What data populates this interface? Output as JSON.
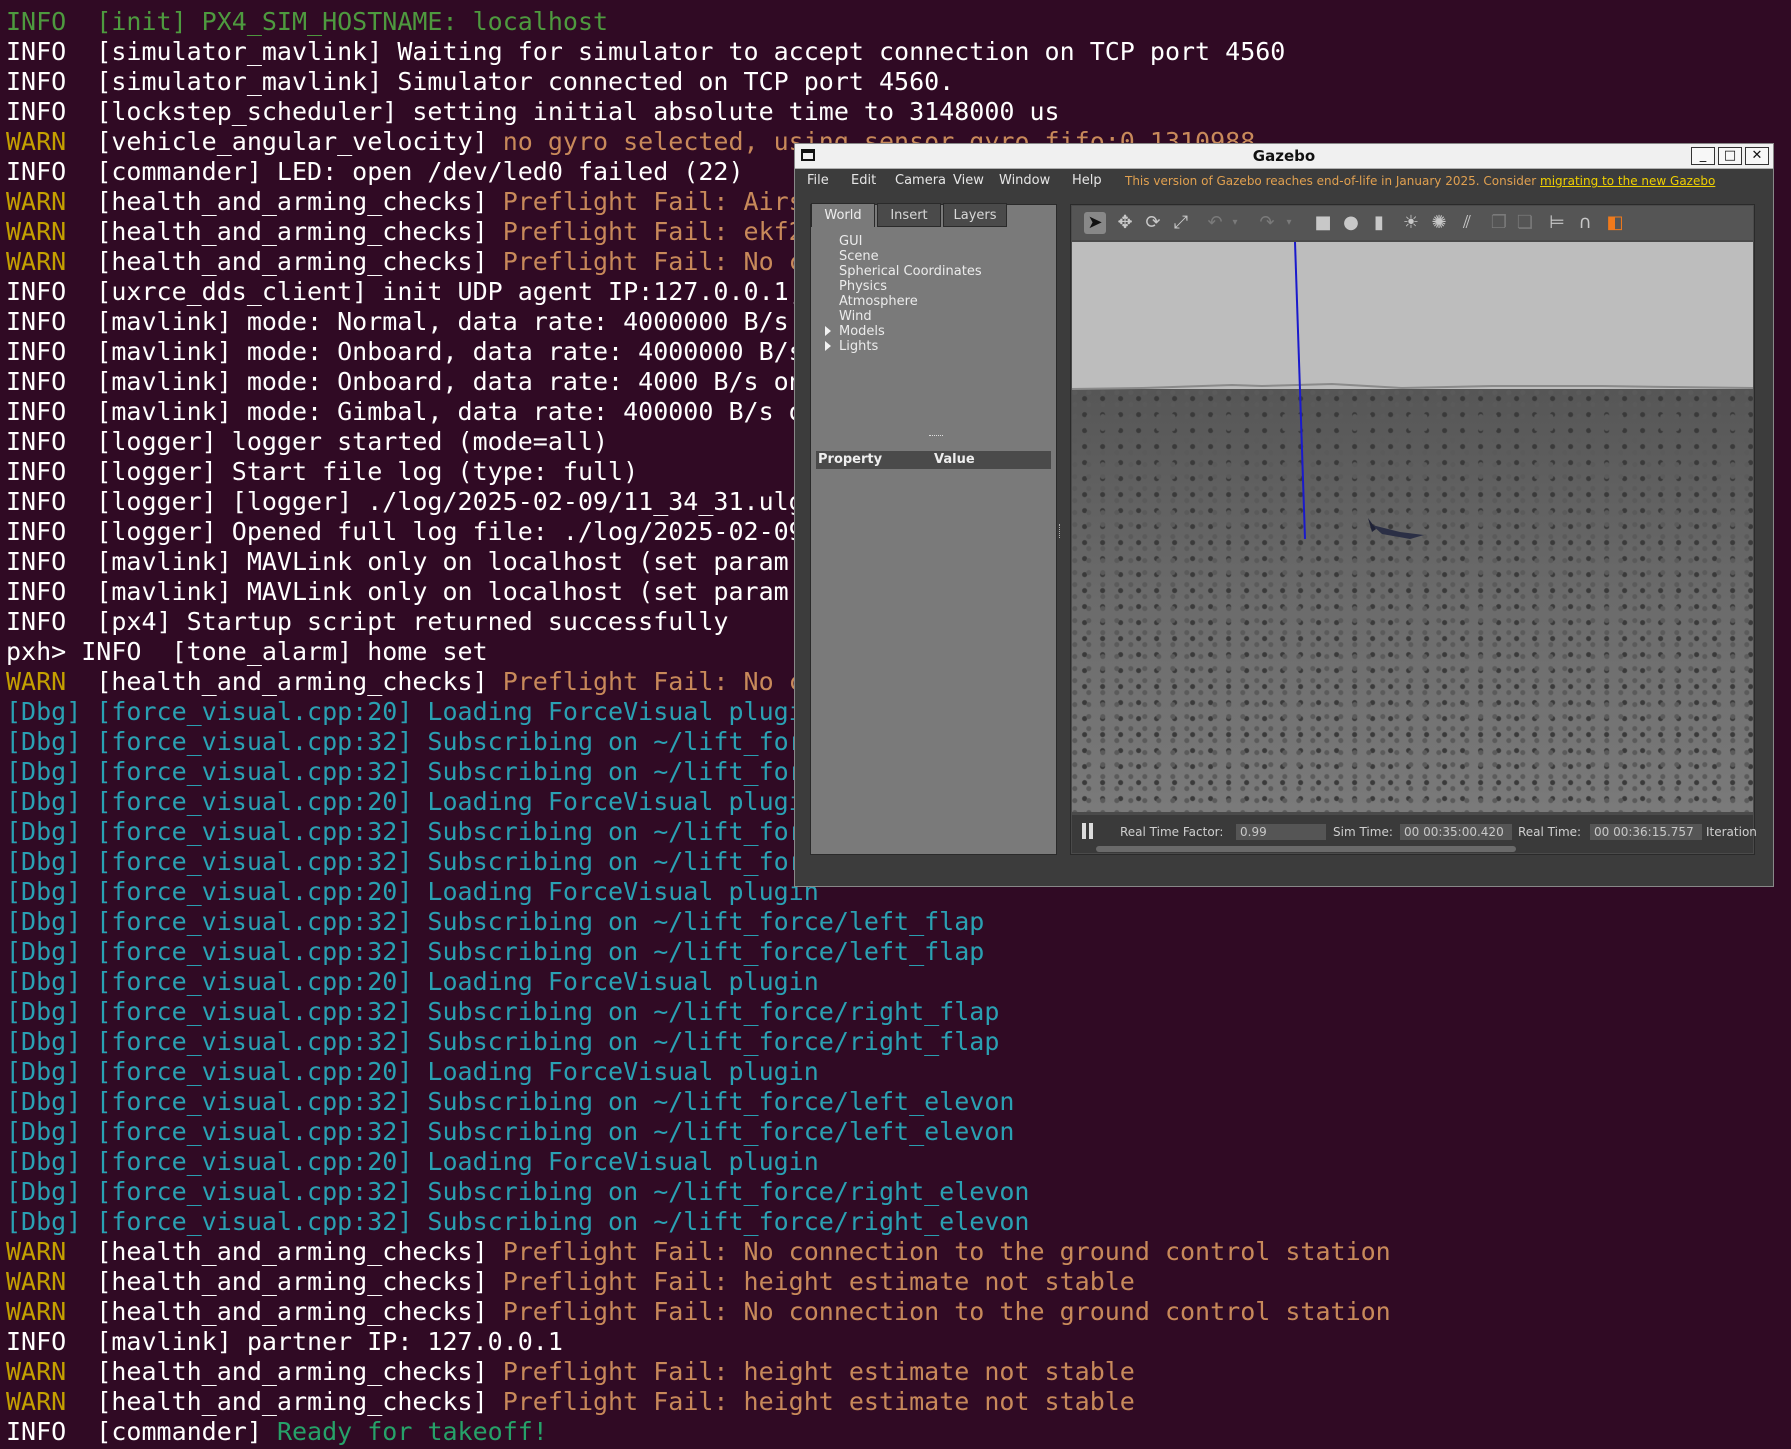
{
  "terminal": {
    "lines": [
      {
        "parts": [
          {
            "t": "INFO  [init] PX4_SIM_HOSTNAME: localhost",
            "c": "green"
          }
        ]
      },
      {
        "parts": [
          {
            "t": "INFO  [simulator_mavlink] Waiting for simulator to accept connection on TCP port 4560",
            "c": "white"
          }
        ]
      },
      {
        "parts": [
          {
            "t": "INFO  [simulator_mavlink] Simulator connected on TCP port 4560.",
            "c": "white"
          }
        ]
      },
      {
        "parts": [
          {
            "t": "INFO  [lockstep_scheduler] setting initial absolute time to 3148000 us",
            "c": "white"
          }
        ]
      },
      {
        "parts": [
          {
            "t": "WARN  ",
            "c": "yellow"
          },
          {
            "t": "[vehicle_angular_velocity] ",
            "c": "white"
          },
          {
            "t": "no gyro selected, using sensor_gyro_fifo:0 1310988",
            "c": "orange"
          }
        ]
      },
      {
        "parts": [
          {
            "t": "INFO  [commander] LED: open /dev/led0 failed (22)",
            "c": "white"
          }
        ]
      },
      {
        "parts": [
          {
            "t": "WARN  ",
            "c": "yellow"
          },
          {
            "t": "[health_and_arming_checks] ",
            "c": "white"
          },
          {
            "t": "Preflight Fail: Airs",
            "c": "orange"
          }
        ]
      },
      {
        "parts": [
          {
            "t": "WARN  ",
            "c": "yellow"
          },
          {
            "t": "[health_and_arming_checks] ",
            "c": "white"
          },
          {
            "t": "Preflight Fail: ekf2",
            "c": "orange"
          }
        ]
      },
      {
        "parts": [
          {
            "t": "WARN  ",
            "c": "yellow"
          },
          {
            "t": "[health_and_arming_checks] ",
            "c": "white"
          },
          {
            "t": "Preflight Fail: No c",
            "c": "orange"
          }
        ]
      },
      {
        "parts": [
          {
            "t": "INFO  [uxrce_dds_client] init UDP agent IP:127.0.0.1,",
            "c": "white"
          }
        ]
      },
      {
        "parts": [
          {
            "t": "INFO  [mavlink] mode: Normal, data rate: 4000000 B/s",
            "c": "white"
          }
        ]
      },
      {
        "parts": [
          {
            "t": "INFO  [mavlink] mode: Onboard, data rate: 4000000 B/s",
            "c": "white"
          }
        ]
      },
      {
        "parts": [
          {
            "t": "INFO  [mavlink] mode: Onboard, data rate: 4000 B/s on",
            "c": "white"
          }
        ]
      },
      {
        "parts": [
          {
            "t": "INFO  [mavlink] mode: Gimbal, data rate: 400000 B/s o",
            "c": "white"
          }
        ]
      },
      {
        "parts": [
          {
            "t": "INFO  [logger] logger started (mode=all)",
            "c": "white"
          }
        ]
      },
      {
        "parts": [
          {
            "t": "INFO  [logger] Start file log (type: full)",
            "c": "white"
          }
        ]
      },
      {
        "parts": [
          {
            "t": "INFO  [logger] [logger] ./log/2025-02-09/11_34_31.ulg",
            "c": "white"
          }
        ]
      },
      {
        "parts": [
          {
            "t": "INFO  [logger] Opened full log file: ./log/2025-02-09",
            "c": "white"
          }
        ]
      },
      {
        "parts": [
          {
            "t": "INFO  [mavlink] MAVLink only on localhost (set param",
            "c": "white"
          }
        ]
      },
      {
        "parts": [
          {
            "t": "INFO  [mavlink] MAVLink only on localhost (set param",
            "c": "white"
          }
        ]
      },
      {
        "parts": [
          {
            "t": "INFO  [px4] Startup script returned successfully",
            "c": "white"
          }
        ]
      },
      {
        "parts": [
          {
            "t": "pxh> INFO  [tone_alarm] home set",
            "c": "white"
          }
        ]
      },
      {
        "parts": [
          {
            "t": "WARN  ",
            "c": "yellow"
          },
          {
            "t": "[health_and_arming_checks] ",
            "c": "white"
          },
          {
            "t": "Preflight Fail: No c",
            "c": "orange"
          }
        ]
      },
      {
        "parts": [
          {
            "t": "[Dbg] [force_visual.cpp:20] Loading ForceVisual plugi",
            "c": "cyan"
          }
        ]
      },
      {
        "parts": [
          {
            "t": "[Dbg] [force_visual.cpp:32] Subscribing on ~/lift_for",
            "c": "cyan"
          }
        ]
      },
      {
        "parts": [
          {
            "t": "[Dbg] [force_visual.cpp:32] Subscribing on ~/lift_for",
            "c": "cyan"
          }
        ]
      },
      {
        "parts": [
          {
            "t": "[Dbg] [force_visual.cpp:20] Loading ForceVisual plugi",
            "c": "cyan"
          }
        ]
      },
      {
        "parts": [
          {
            "t": "[Dbg] [force_visual.cpp:32] Subscribing on ~/lift_for",
            "c": "cyan"
          }
        ]
      },
      {
        "parts": [
          {
            "t": "[Dbg] [force_visual.cpp:32] Subscribing on ~/lift_for",
            "c": "cyan"
          }
        ]
      },
      {
        "parts": [
          {
            "t": "[Dbg] [force_visual.cpp:20] Loading ForceVisual plugin",
            "c": "cyan"
          }
        ]
      },
      {
        "parts": [
          {
            "t": "[Dbg] [force_visual.cpp:32] Subscribing on ~/lift_force/left_flap",
            "c": "cyan"
          }
        ]
      },
      {
        "parts": [
          {
            "t": "[Dbg] [force_visual.cpp:32] Subscribing on ~/lift_force/left_flap",
            "c": "cyan"
          }
        ]
      },
      {
        "parts": [
          {
            "t": "[Dbg] [force_visual.cpp:20] Loading ForceVisual plugin",
            "c": "cyan"
          }
        ]
      },
      {
        "parts": [
          {
            "t": "[Dbg] [force_visual.cpp:32] Subscribing on ~/lift_force/right_flap",
            "c": "cyan"
          }
        ]
      },
      {
        "parts": [
          {
            "t": "[Dbg] [force_visual.cpp:32] Subscribing on ~/lift_force/right_flap",
            "c": "cyan"
          }
        ]
      },
      {
        "parts": [
          {
            "t": "[Dbg] [force_visual.cpp:20] Loading ForceVisual plugin",
            "c": "cyan"
          }
        ]
      },
      {
        "parts": [
          {
            "t": "[Dbg] [force_visual.cpp:32] Subscribing on ~/lift_force/left_elevon",
            "c": "cyan"
          }
        ]
      },
      {
        "parts": [
          {
            "t": "[Dbg] [force_visual.cpp:32] Subscribing on ~/lift_force/left_elevon",
            "c": "cyan"
          }
        ]
      },
      {
        "parts": [
          {
            "t": "[Dbg] [force_visual.cpp:20] Loading ForceVisual plugin",
            "c": "cyan"
          }
        ]
      },
      {
        "parts": [
          {
            "t": "[Dbg] [force_visual.cpp:32] Subscribing on ~/lift_force/right_elevon",
            "c": "cyan"
          }
        ]
      },
      {
        "parts": [
          {
            "t": "[Dbg] [force_visual.cpp:32] Subscribing on ~/lift_force/right_elevon",
            "c": "cyan"
          }
        ]
      },
      {
        "parts": [
          {
            "t": "WARN  ",
            "c": "yellow"
          },
          {
            "t": "[health_and_arming_checks] ",
            "c": "white"
          },
          {
            "t": "Preflight Fail: No connection to the ground control station",
            "c": "orange"
          }
        ]
      },
      {
        "parts": [
          {
            "t": "WARN  ",
            "c": "yellow"
          },
          {
            "t": "[health_and_arming_checks] ",
            "c": "white"
          },
          {
            "t": "Preflight Fail: height estimate not stable",
            "c": "orange"
          }
        ]
      },
      {
        "parts": [
          {
            "t": "WARN  ",
            "c": "yellow"
          },
          {
            "t": "[health_and_arming_checks] ",
            "c": "white"
          },
          {
            "t": "Preflight Fail: No connection to the ground control station",
            "c": "orange"
          }
        ]
      },
      {
        "parts": [
          {
            "t": "INFO  [mavlink] partner IP: 127.0.0.1",
            "c": "white"
          }
        ]
      },
      {
        "parts": [
          {
            "t": "WARN  ",
            "c": "yellow"
          },
          {
            "t": "[health_and_arming_checks] ",
            "c": "white"
          },
          {
            "t": "Preflight Fail: height estimate not stable",
            "c": "orange"
          }
        ]
      },
      {
        "parts": [
          {
            "t": "WARN  ",
            "c": "yellow"
          },
          {
            "t": "[health_and_arming_checks] ",
            "c": "white"
          },
          {
            "t": "Preflight Fail: height estimate not stable",
            "c": "orange"
          }
        ]
      },
      {
        "parts": [
          {
            "t": "INFO  [commander] ",
            "c": "white"
          },
          {
            "t": "Ready for takeoff!",
            "c": "readygreen"
          }
        ]
      }
    ]
  },
  "gazebo": {
    "title": "Gazebo",
    "menu": [
      "File",
      "Edit",
      "Camera",
      "View",
      "Window",
      "Help"
    ],
    "notice_text": "This version of Gazebo reaches end-of-life in January 2025. Consider ",
    "notice_link": "migrating to the new Gazebo",
    "tabs": [
      "World",
      "Insert",
      "Layers"
    ],
    "tree": [
      "GUI",
      "Scene",
      "Spherical Coordinates",
      "Physics",
      "Atmosphere",
      "Wind",
      "Models",
      "Lights"
    ],
    "property_header": "Property",
    "value_header": "Value",
    "status": {
      "rtf_label": "Real Time Factor:",
      "rtf_value": "0.99",
      "sim_label": "Sim Time:",
      "sim_value": "00 00:35:00.420",
      "real_label": "Real Time:",
      "real_value": "00 00:36:15.757",
      "iter_label": "Iteration"
    },
    "toolbar_icons": [
      "select-arrow-icon",
      "translate-icon",
      "rotate-icon",
      "scale-icon",
      "undo-icon",
      "undo-dropdown-icon",
      "redo-icon",
      "redo-dropdown-icon",
      "box-icon",
      "sphere-icon",
      "cylinder-icon",
      "point-light-icon",
      "spot-light-icon",
      "directional-light-icon",
      "copy-icon",
      "paste-icon",
      "align-icon",
      "snap-icon",
      "change-view-icon"
    ]
  },
  "colors": {
    "bg": "#300a24",
    "white": "#ffffff",
    "green": "#4e9a3f",
    "yellow": "#c4a000",
    "orange": "#c8895a",
    "cyan": "#2aa1b3",
    "readygreen": "#26a269",
    "accent": "#f07a1c"
  }
}
